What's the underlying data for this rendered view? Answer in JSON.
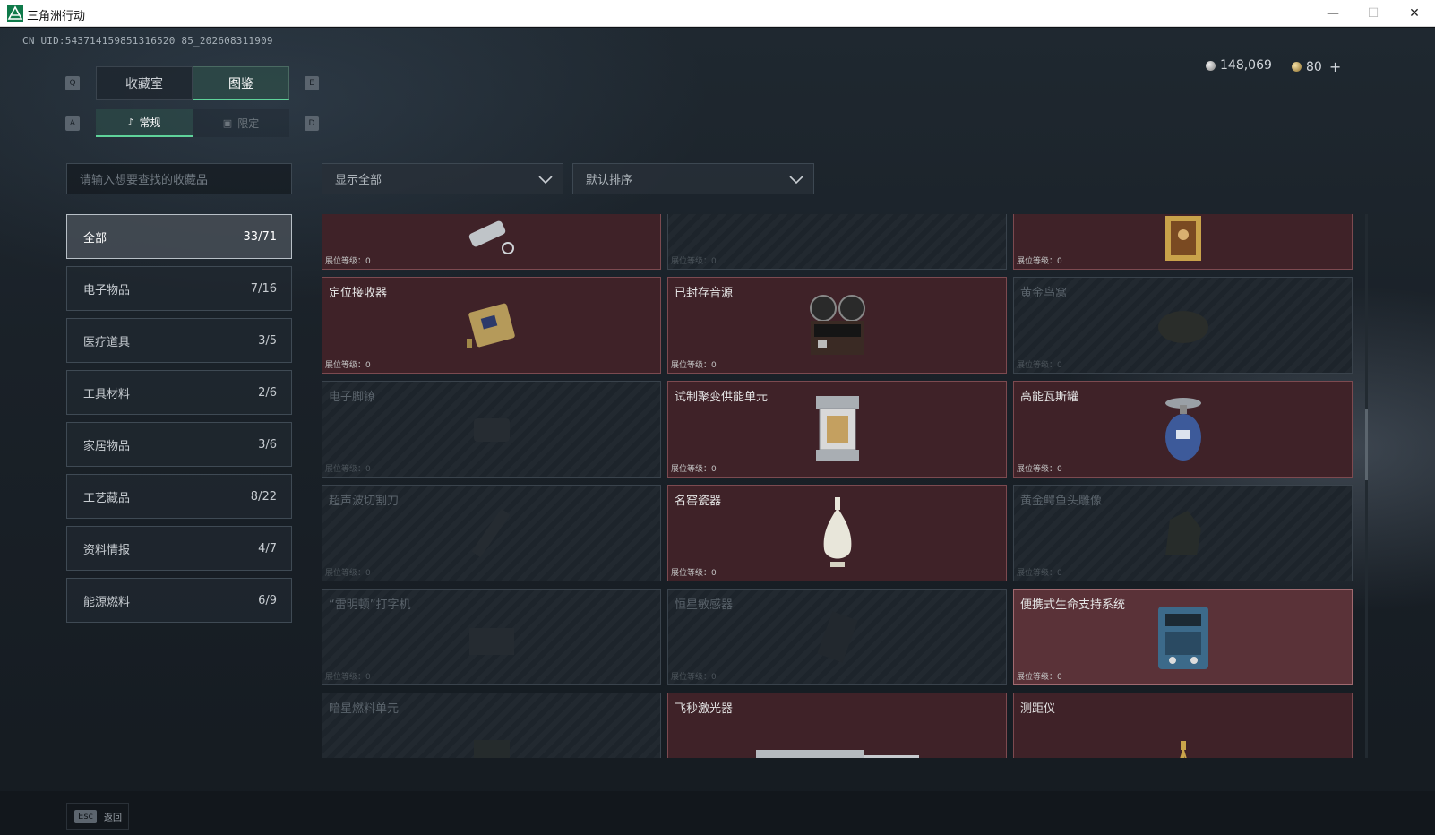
{
  "window": {
    "title": "三角洲行动",
    "minimize": "—",
    "maximize": "☐",
    "close": "✕"
  },
  "uid": "CN UID:543714159851316520 85_202608311909",
  "currency": {
    "silver": "148,069",
    "gold": "80",
    "plus": "+"
  },
  "keys": {
    "q": "Q",
    "e": "E",
    "a": "A",
    "d": "D"
  },
  "tabs": {
    "main": [
      "收藏室",
      "图鉴"
    ],
    "sub": [
      "常规",
      "限定"
    ],
    "active_main": "图鉴",
    "active_sub": "常规"
  },
  "search": {
    "placeholder": "请输入想要查找的收藏品"
  },
  "filters": {
    "show": "显示全部",
    "sort": "默认排序"
  },
  "categories": [
    {
      "label": "全部",
      "count": "33/71"
    },
    {
      "label": "电子物品",
      "count": "7/16"
    },
    {
      "label": "医疗道具",
      "count": "3/5"
    },
    {
      "label": "工具材料",
      "count": "2/6"
    },
    {
      "label": "家居物品",
      "count": "3/6"
    },
    {
      "label": "工艺藏品",
      "count": "8/22"
    },
    {
      "label": "资料情报",
      "count": "4/7"
    },
    {
      "label": "能源燃料",
      "count": "6/9"
    }
  ],
  "level_label": "展位等级：",
  "items": [
    {
      "name": "",
      "level": "0",
      "owned": true,
      "icon": "flashlight-icon"
    },
    {
      "name": "",
      "level": "0",
      "owned": false,
      "icon": "device-icon"
    },
    {
      "name": "",
      "level": "0",
      "owned": true,
      "icon": "painting-icon"
    },
    {
      "name": "定位接收器",
      "level": "0",
      "owned": true,
      "icon": "gps-receiver-icon"
    },
    {
      "name": "已封存音源",
      "level": "0",
      "owned": true,
      "icon": "reel-recorder-icon"
    },
    {
      "name": "黄金鸟窝",
      "level": "0",
      "owned": false,
      "icon": "golden-nest-icon"
    },
    {
      "name": "电子脚镣",
      "level": "0",
      "owned": false,
      "icon": "ankle-monitor-icon"
    },
    {
      "name": "试制聚变供能单元",
      "level": "0",
      "owned": true,
      "icon": "fusion-cell-icon"
    },
    {
      "name": "高能瓦斯罐",
      "level": "0",
      "owned": true,
      "icon": "gas-canister-icon"
    },
    {
      "name": "超声波切割刀",
      "level": "0",
      "owned": false,
      "icon": "ultrasonic-cutter-icon"
    },
    {
      "name": "名窑瓷器",
      "level": "0",
      "owned": true,
      "icon": "porcelain-vase-icon"
    },
    {
      "name": "黄金鳄鱼头雕像",
      "level": "0",
      "owned": false,
      "icon": "golden-statue-icon"
    },
    {
      "name": "“雷明顿”打字机",
      "level": "0",
      "owned": false,
      "icon": "typewriter-icon"
    },
    {
      "name": "恒星敏感器",
      "level": "0",
      "owned": false,
      "icon": "star-sensor-icon"
    },
    {
      "name": "便携式生命支持系统",
      "level": "0",
      "owned": true,
      "icon": "life-support-icon"
    },
    {
      "name": "暗星燃料单元",
      "level": "",
      "owned": false,
      "icon": "fuel-cell-icon"
    },
    {
      "name": "飞秒激光器",
      "level": "",
      "owned": true,
      "icon": "laser-icon"
    },
    {
      "name": "测距仪",
      "level": "",
      "owned": true,
      "icon": "rangefinder-icon"
    }
  ],
  "footer": {
    "esc_key": "Esc",
    "back_label": "返回"
  },
  "colors": {
    "accent": "#5fd39a",
    "owned_card": "#3f2228",
    "locked_card": "#1d242b"
  }
}
